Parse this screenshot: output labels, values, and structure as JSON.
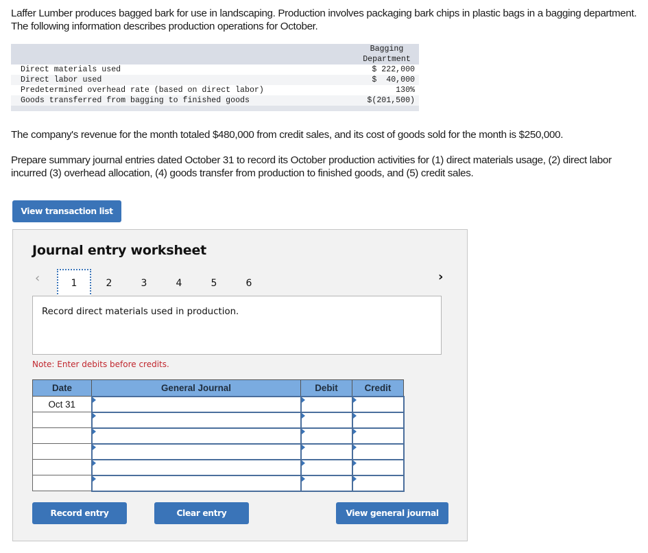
{
  "problem": {
    "intro": "Laffer Lumber produces bagged bark for use in landscaping. Production involves packaging bark chips in plastic bags in a bagging department. The following information describes production operations for October.",
    "table": {
      "header_line1": "Bagging",
      "header_line2": "Department",
      "rows": [
        {
          "label": "Direct materials used",
          "value": "$ 222,000"
        },
        {
          "label": "Direct labor used",
          "value": "$  40,000"
        },
        {
          "label": "Predetermined overhead rate (based on direct labor)",
          "value": "130%"
        },
        {
          "label": "Goods transferred from bagging to finished goods",
          "value": "$(201,500)"
        }
      ]
    },
    "revenue_text": "The company's revenue for the month totaled $480,000 from credit sales, and its cost of goods sold for the month is $250,000.",
    "instructions": "Prepare summary journal entries dated October 31 to record its October production activities for (1) direct materials usage, (2) direct labor incurred (3) overhead allocation, (4) goods transfer from production to finished goods, and (5) credit sales."
  },
  "buttons": {
    "view_transaction_list": "View transaction list",
    "record_entry": "Record entry",
    "clear_entry": "Clear entry",
    "view_general_journal": "View general journal"
  },
  "worksheet": {
    "title": "Journal entry worksheet",
    "prev_icon": "‹",
    "next_icon": "›",
    "tabs": [
      "1",
      "2",
      "3",
      "4",
      "5",
      "6"
    ],
    "active_tab": "1",
    "prompt": "Record direct materials used in production.",
    "note": "Note: Enter debits before credits.",
    "columns": {
      "date": "Date",
      "account": "General Journal",
      "debit": "Debit",
      "credit": "Credit"
    },
    "rows": [
      {
        "date": "Oct 31",
        "account": "",
        "debit": "",
        "credit": ""
      },
      {
        "date": "",
        "account": "",
        "debit": "",
        "credit": ""
      },
      {
        "date": "",
        "account": "",
        "debit": "",
        "credit": ""
      },
      {
        "date": "",
        "account": "",
        "debit": "",
        "credit": ""
      },
      {
        "date": "",
        "account": "",
        "debit": "",
        "credit": ""
      },
      {
        "date": "",
        "account": "",
        "debit": "",
        "credit": ""
      }
    ]
  },
  "colors": {
    "button_blue": "#3a74b8",
    "header_blue": "#7aabe0",
    "note_red": "#c0262d",
    "panel_bg": "#f2f2f2"
  }
}
